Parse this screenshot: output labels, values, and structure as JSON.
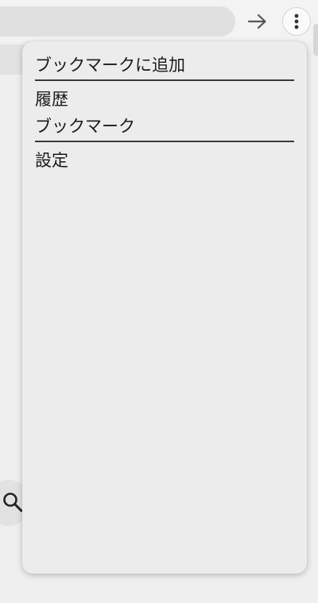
{
  "toolbar": {
    "forward_icon": "arrow-right-icon",
    "menu_icon": "more-vert-icon"
  },
  "background": {
    "search_icon": "search-icon"
  },
  "menu": {
    "items": [
      {
        "label": "ブックマークに追加"
      },
      {
        "label": "履歴"
      },
      {
        "label": "ブックマーク"
      },
      {
        "label": "設定"
      }
    ]
  },
  "colors": {
    "page_bg": "#efefef",
    "menu_bg": "#ececec",
    "separator": "#3a3a3a",
    "text": "#1a1a1a"
  }
}
